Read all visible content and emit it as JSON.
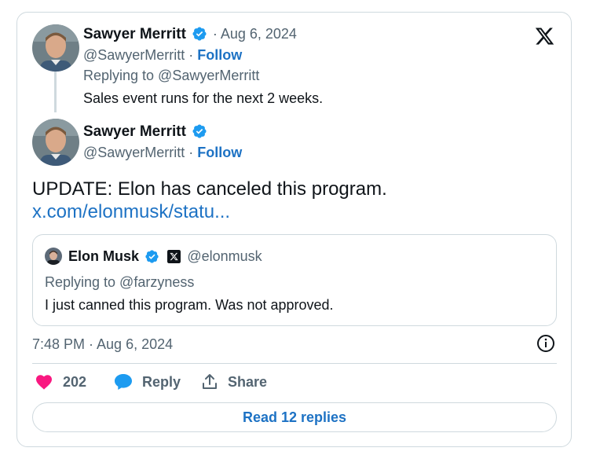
{
  "parent_tweet": {
    "author_name": "Sawyer Merritt",
    "handle": "@SawyerMerritt",
    "separator": " · ",
    "date": "· Aug 6, 2024",
    "follow_label": "Follow",
    "replying_to": "Replying to @SawyerMerritt",
    "text": "Sales event runs for the next 2 weeks."
  },
  "main_tweet": {
    "author_name": "Sawyer Merritt",
    "handle": "@SawyerMerritt",
    "separator": " · ",
    "follow_label": "Follow",
    "text": "UPDATE: Elon has canceled this program.",
    "link": "x.com/elonmusk/statu..."
  },
  "quoted_tweet": {
    "author_name": "Elon Musk",
    "handle": "@elonmusk",
    "replying_to": "Replying to @farzyness",
    "text": "I just canned this program. Was not approved."
  },
  "timestamp": "7:48 PM · Aug 6, 2024",
  "actions": {
    "like_count": "202",
    "reply_label": "Reply",
    "share_label": "Share",
    "read_replies_label": "Read 12 replies"
  },
  "colors": {
    "verified_blue": "#1d9bf0",
    "link_blue": "#1d72c4",
    "like_pink": "#f91880",
    "muted_gray": "#536471",
    "border": "#cfd9de"
  },
  "icons": [
    "x-logo-icon",
    "verified-badge-icon",
    "heart-icon",
    "reply-bubble-icon",
    "share-icon",
    "info-icon"
  ]
}
